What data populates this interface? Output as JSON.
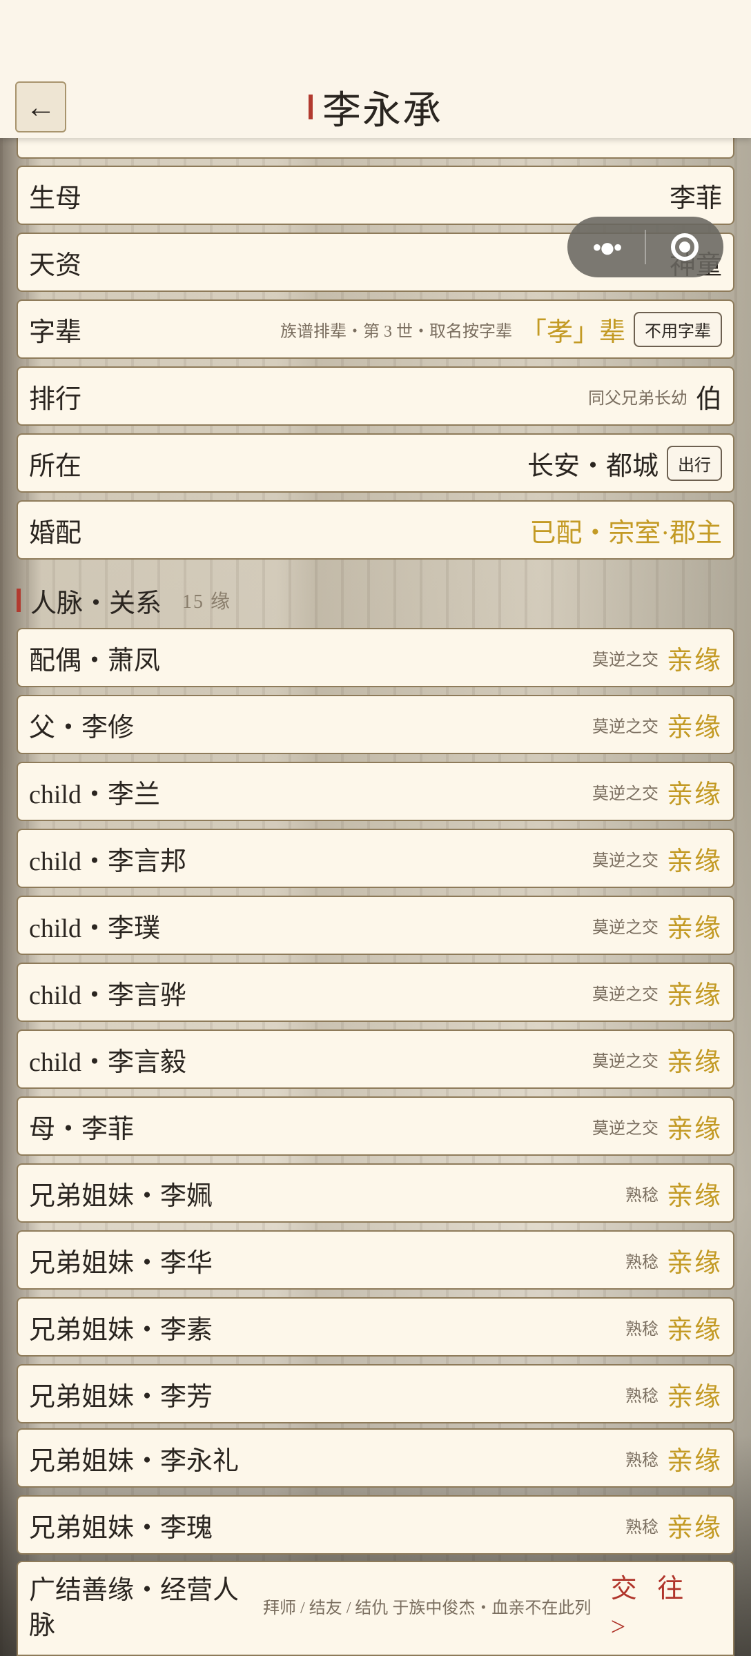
{
  "header": {
    "back_icon": "←",
    "title": "李永承"
  },
  "attributes": [
    {
      "label": "生母",
      "value": "李菲"
    },
    {
      "label": "天资",
      "value": "神童"
    },
    {
      "label": "字辈",
      "note": "族谱排辈・第 3 世・取名按字辈",
      "value": "「孝」辈",
      "button": "不用字辈"
    },
    {
      "label": "排行",
      "note": "同父兄弟长幼",
      "value": "伯"
    },
    {
      "label": "所在",
      "value": "长安・都城",
      "button": "出行"
    },
    {
      "label": "婚配",
      "value": "已配・宗室·郡主"
    }
  ],
  "relations_section": {
    "title": "人脉・关系",
    "count": "15 缘"
  },
  "relations": [
    {
      "name": "配偶・萧凤",
      "level": "莫逆之交",
      "tag": "亲缘"
    },
    {
      "name": "父・李修",
      "level": "莫逆之交",
      "tag": "亲缘"
    },
    {
      "name": "child・李兰",
      "level": "莫逆之交",
      "tag": "亲缘"
    },
    {
      "name": "child・李言邦",
      "level": "莫逆之交",
      "tag": "亲缘"
    },
    {
      "name": "child・李璞",
      "level": "莫逆之交",
      "tag": "亲缘"
    },
    {
      "name": "child・李言骅",
      "level": "莫逆之交",
      "tag": "亲缘"
    },
    {
      "name": "child・李言毅",
      "level": "莫逆之交",
      "tag": "亲缘"
    },
    {
      "name": "母・李菲",
      "level": "莫逆之交",
      "tag": "亲缘"
    },
    {
      "name": "兄弟姐妹・李姵",
      "level": "熟稔",
      "tag": "亲缘"
    },
    {
      "name": "兄弟姐妹・李华",
      "level": "熟稔",
      "tag": "亲缘"
    },
    {
      "name": "兄弟姐妹・李素",
      "level": "熟稔",
      "tag": "亲缘"
    },
    {
      "name": "兄弟姐妹・李芳",
      "level": "熟稔",
      "tag": "亲缘"
    },
    {
      "name": "兄弟姐妹・李永礼",
      "level": "熟稔",
      "tag": "亲缘"
    },
    {
      "name": "兄弟姐妹・李瑰",
      "level": "熟稔",
      "tag": "亲缘"
    }
  ],
  "network": {
    "title": "广结善缘・经营人脉",
    "desc": "拜师 / 结友 / 结仇 于族中俊杰・血亲不在此列",
    "action": "交 往 >"
  }
}
